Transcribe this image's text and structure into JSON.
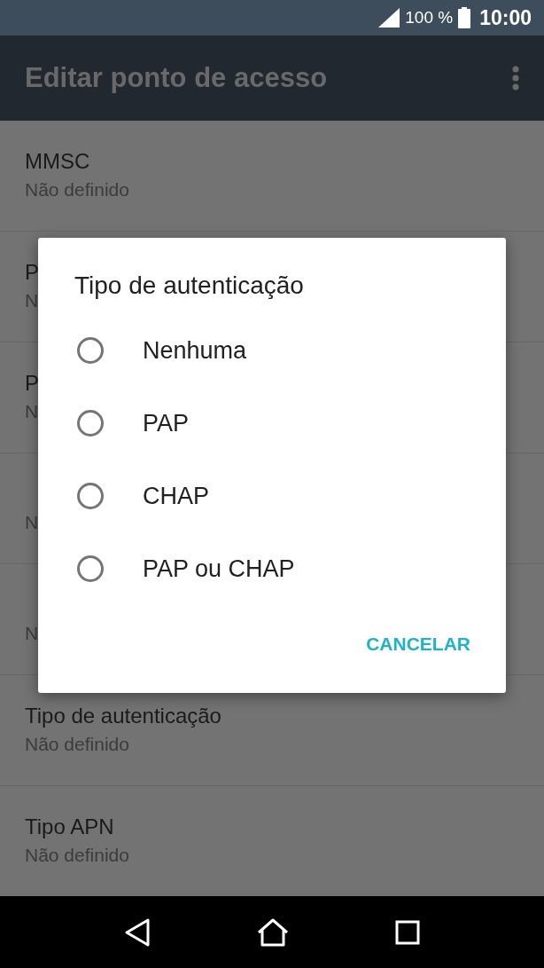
{
  "status_bar": {
    "battery": "100 %",
    "time": "10:00"
  },
  "app_bar": {
    "title": "Editar ponto de acesso"
  },
  "settings": [
    {
      "title": "MMSC",
      "value": "Não definido"
    },
    {
      "title": "P",
      "value": "N"
    },
    {
      "title": "P",
      "value": "N"
    },
    {
      "value": "N"
    },
    {
      "value": "N"
    },
    {
      "title": "Tipo de autenticação",
      "value": "Não definido"
    },
    {
      "title": "Tipo APN",
      "value": "Não definido"
    }
  ],
  "dialog": {
    "title": "Tipo de autenticação",
    "options": [
      {
        "label": "Nenhuma",
        "selected": false
      },
      {
        "label": "PAP",
        "selected": false
      },
      {
        "label": "CHAP",
        "selected": false
      },
      {
        "label": "PAP ou CHAP",
        "selected": false
      }
    ],
    "button": "CANCELAR"
  }
}
